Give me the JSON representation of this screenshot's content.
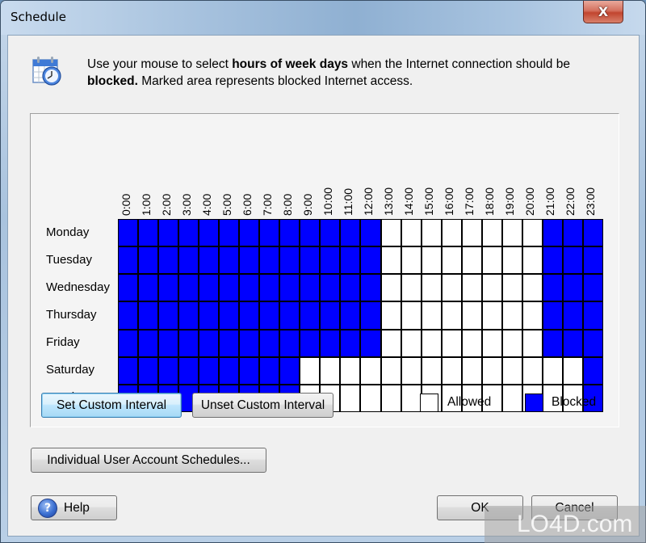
{
  "window": {
    "title": "Schedule",
    "close_glyph": "X"
  },
  "intro": {
    "icon": "calendar-clock-icon",
    "text_1": "Use your mouse to select ",
    "bold_1": "hours of week days",
    "text_2": " when the Internet connection should be ",
    "bold_2": "blocked.",
    "text_3": " Marked area represents blocked Internet access."
  },
  "schedule": {
    "hours": [
      "0:00",
      "1:00",
      "2:00",
      "3:00",
      "4:00",
      "5:00",
      "6:00",
      "7:00",
      "8:00",
      "9:00",
      "10:00",
      "11:00",
      "12:00",
      "13:00",
      "14:00",
      "15:00",
      "16:00",
      "17:00",
      "18:00",
      "19:00",
      "20:00",
      "21:00",
      "22:00",
      "23:00"
    ],
    "days": [
      {
        "name": "Monday",
        "blocked": [
          1,
          1,
          1,
          1,
          1,
          1,
          1,
          1,
          1,
          1,
          1,
          1,
          1,
          0,
          0,
          0,
          0,
          0,
          0,
          0,
          0,
          1,
          1,
          1
        ]
      },
      {
        "name": "Tuesday",
        "blocked": [
          1,
          1,
          1,
          1,
          1,
          1,
          1,
          1,
          1,
          1,
          1,
          1,
          1,
          0,
          0,
          0,
          0,
          0,
          0,
          0,
          0,
          1,
          1,
          1
        ]
      },
      {
        "name": "Wednesday",
        "blocked": [
          1,
          1,
          1,
          1,
          1,
          1,
          1,
          1,
          1,
          1,
          1,
          1,
          1,
          0,
          0,
          0,
          0,
          0,
          0,
          0,
          0,
          1,
          1,
          1
        ]
      },
      {
        "name": "Thursday",
        "blocked": [
          1,
          1,
          1,
          1,
          1,
          1,
          1,
          1,
          1,
          1,
          1,
          1,
          1,
          0,
          0,
          0,
          0,
          0,
          0,
          0,
          0,
          1,
          1,
          1
        ]
      },
      {
        "name": "Friday",
        "blocked": [
          1,
          1,
          1,
          1,
          1,
          1,
          1,
          1,
          1,
          1,
          1,
          1,
          1,
          0,
          0,
          0,
          0,
          0,
          0,
          0,
          0,
          1,
          1,
          1
        ]
      },
      {
        "name": "Saturday",
        "blocked": [
          1,
          1,
          1,
          1,
          1,
          1,
          1,
          1,
          1,
          0,
          0,
          0,
          0,
          0,
          0,
          0,
          0,
          0,
          0,
          0,
          0,
          0,
          0,
          1
        ]
      },
      {
        "name": "Sunday",
        "blocked": [
          1,
          1,
          1,
          1,
          1,
          1,
          1,
          1,
          1,
          0,
          0,
          0,
          0,
          0,
          0,
          0,
          0,
          0,
          0,
          0,
          0,
          0,
          0,
          1
        ]
      }
    ],
    "colors": {
      "allowed": "#ffffff",
      "blocked": "#0000ff"
    }
  },
  "buttons": {
    "set_interval": "Set Custom Interval",
    "unset_interval": "Unset Custom Interval",
    "user_schedules": "Individual User Account Schedules...",
    "help": "Help",
    "ok": "OK",
    "cancel": "Cancel"
  },
  "legend": {
    "allowed": "Allowed",
    "blocked": "Blocked"
  },
  "watermark": "LO4D.com"
}
